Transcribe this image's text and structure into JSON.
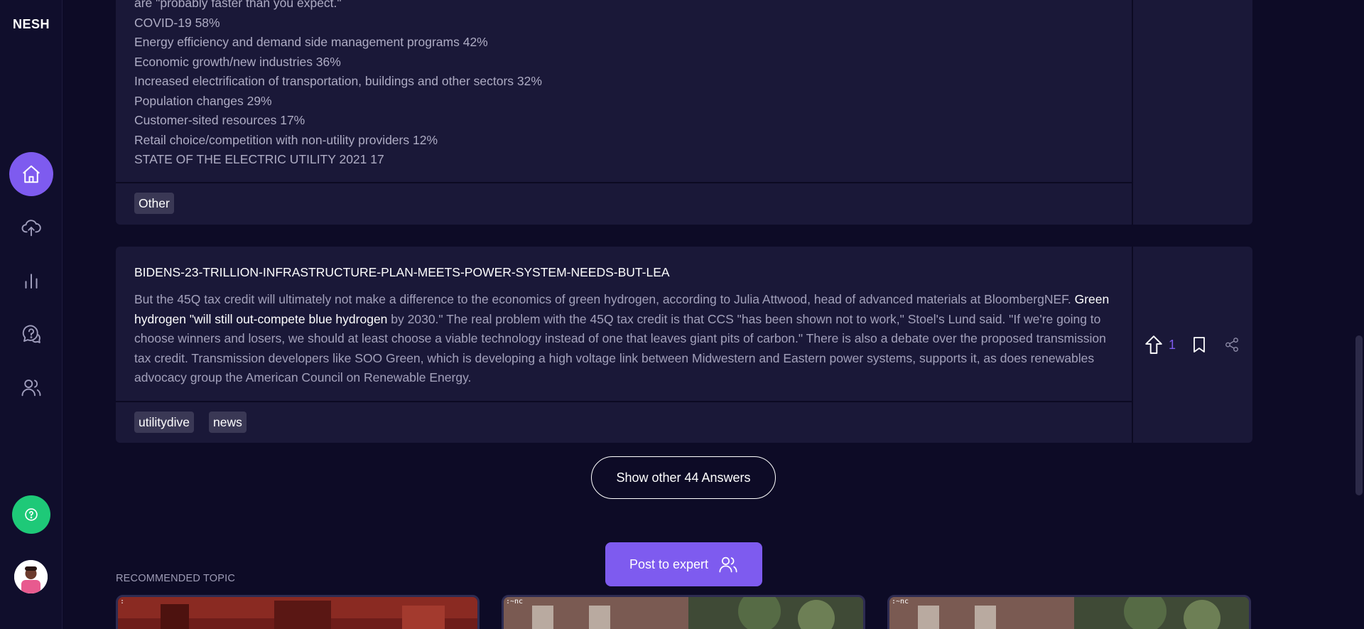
{
  "app": {
    "logo": "NESH"
  },
  "sidebar": {
    "items": [
      {
        "name": "home",
        "icon": "home-icon"
      },
      {
        "name": "upload",
        "icon": "cloud-upload-icon"
      },
      {
        "name": "analytics",
        "icon": "bar-chart-icon"
      },
      {
        "name": "questions",
        "icon": "question-chat-icon"
      },
      {
        "name": "experts",
        "icon": "users-icon"
      }
    ],
    "help_icon": "help-icon",
    "avatar_icon": "avatar"
  },
  "card1": {
    "lines": [
      "are \"probably faster than you expect.\"",
      "COVID-19 58%",
      "Energy efficiency and demand side management programs 42%",
      "Economic growth/new industries 36%",
      "Increased electrification of transportation, buildings and other sectors 32%",
      "Population changes 29%",
      "Customer-sited resources 17%",
      "Retail choice/competition with non-utility providers 12%",
      "STATE OF THE ELECTRIC UTILITY 2021 17"
    ],
    "tags": [
      "Other"
    ]
  },
  "card2": {
    "title": "BIDENS-23-TRILLION-INFRASTRUCTURE-PLAN-MEETS-POWER-SYSTEM-NEEDS-BUT-LEA",
    "text_before": "But the 45Q tax credit will ultimately not make a difference to the economics of green hydrogen, according to Julia Attwood, head of advanced materials at BloombergNEF. ",
    "text_highlight": "Green hydrogen \"will still out-compete blue hydrogen",
    "text_after": " by 2030.\" The real problem with the 45Q tax credit is that CCS \"has been shown not to work,\" Stoel's Lund said. \"If we're going to choose winners and losers, we should at least choose a viable technology instead of one that leaves giant pits of carbon.\" There is also a debate over the proposed transmission tax credit. Transmission developers like SOO Green, which is developing a high voltage link between Midwestern and Eastern power systems, supports it, as does renewables advocacy group the American Council on Renewable Energy.",
    "tags": [
      "utilitydive",
      "news"
    ],
    "upvote_count": "1"
  },
  "show_more_label": "Show other 44 Answers",
  "post_expert_label": "Post to expert",
  "recommended_label": "RECOMMENDED TOPIC",
  "thumbs": [
    {
      "label": ":"
    },
    {
      "label": ":~nc"
    },
    {
      "label": ":~nc"
    }
  ],
  "colors": {
    "accent": "#7e5bef",
    "help": "#1ec978",
    "background": "#0d0b26",
    "card": "#1a1838"
  }
}
